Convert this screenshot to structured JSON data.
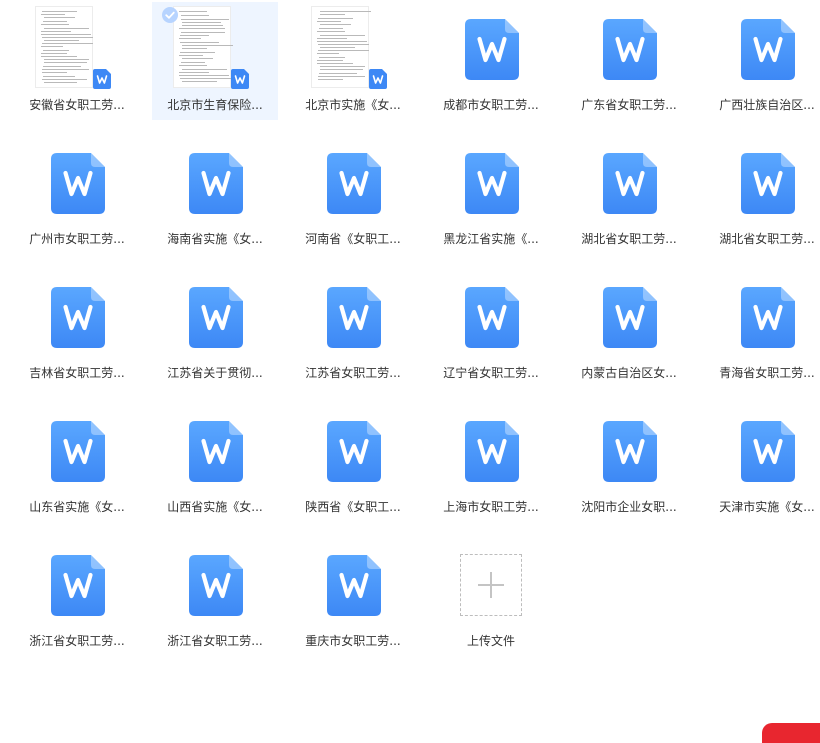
{
  "colors": {
    "doc_blue_top": "#5aa7ff",
    "doc_blue_bottom": "#3d88f5",
    "selected_bg": "#eef5ff",
    "label_text": "#333333"
  },
  "files": [
    {
      "name": "安徽省女职工劳...",
      "icon": "document-preview-icon",
      "selected": false
    },
    {
      "name": "北京市生育保险...",
      "icon": "document-preview-icon",
      "selected": true
    },
    {
      "name": "北京市实施《女...",
      "icon": "document-preview-icon",
      "selected": false
    },
    {
      "name": "成都市女职工劳...",
      "icon": "word-file-icon",
      "selected": false
    },
    {
      "name": "广东省女职工劳...",
      "icon": "word-file-icon",
      "selected": false
    },
    {
      "name": "广西壮族自治区...",
      "icon": "word-file-icon",
      "selected": false
    },
    {
      "name": "广州市女职工劳...",
      "icon": "word-file-icon",
      "selected": false
    },
    {
      "name": "海南省实施《女...",
      "icon": "word-file-icon",
      "selected": false
    },
    {
      "name": "河南省《女职工...",
      "icon": "word-file-icon",
      "selected": false
    },
    {
      "name": "黑龙江省实施《...",
      "icon": "word-file-icon",
      "selected": false
    },
    {
      "name": "湖北省女职工劳...",
      "icon": "word-file-icon",
      "selected": false
    },
    {
      "name": "湖北省女职工劳...",
      "icon": "word-file-icon",
      "selected": false
    },
    {
      "name": "吉林省女职工劳...",
      "icon": "word-file-icon",
      "selected": false
    },
    {
      "name": "江苏省关于贯彻...",
      "icon": "word-file-icon",
      "selected": false
    },
    {
      "name": "江苏省女职工劳...",
      "icon": "word-file-icon",
      "selected": false
    },
    {
      "name": "辽宁省女职工劳...",
      "icon": "word-file-icon",
      "selected": false
    },
    {
      "name": "内蒙古自治区女...",
      "icon": "word-file-icon",
      "selected": false
    },
    {
      "name": "青海省女职工劳...",
      "icon": "word-file-icon",
      "selected": false
    },
    {
      "name": "山东省实施《女...",
      "icon": "word-file-icon",
      "selected": false
    },
    {
      "name": "山西省实施《女...",
      "icon": "word-file-icon",
      "selected": false
    },
    {
      "name": "陕西省《女职工...",
      "icon": "word-file-icon",
      "selected": false
    },
    {
      "name": "上海市女职工劳...",
      "icon": "word-file-icon",
      "selected": false
    },
    {
      "name": "沈阳市企业女职...",
      "icon": "word-file-icon",
      "selected": false
    },
    {
      "name": "天津市实施《女...",
      "icon": "word-file-icon",
      "selected": false
    },
    {
      "name": "浙江省女职工劳...",
      "icon": "word-file-icon",
      "selected": false
    },
    {
      "name": "浙江省女职工劳...",
      "icon": "word-file-icon",
      "selected": false
    },
    {
      "name": "重庆市女职工劳...",
      "icon": "word-file-icon",
      "selected": false
    }
  ],
  "upload": {
    "label": "上传文件",
    "icon": "plus-icon"
  }
}
